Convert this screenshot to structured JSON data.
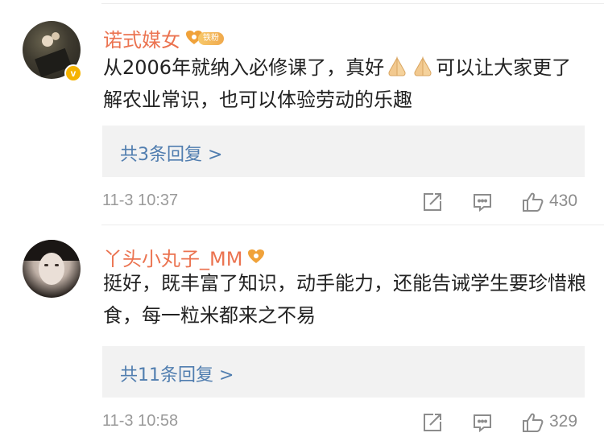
{
  "comments": [
    {
      "username": "诺式媒女",
      "badge_label": "铁粉",
      "verified_mark": "v",
      "text_part1": "从2006年就纳入必修课了，真好",
      "text_part2": "可以让大家更了解农业常识，也可以体验劳动的乐趣",
      "emoji": "praying-hands-icon",
      "replies_label": "共3条回复 >",
      "timestamp": "11-3 10:37",
      "like_count": "430"
    },
    {
      "username": "丫头小丸子_MM",
      "text": "挺好，既丰富了知识，动手能力，还能告诫学生要珍惜粮食，每一粒米都来之不易",
      "replies_label": "共11条回复 >",
      "timestamp": "11-3 10:58",
      "like_count": "329"
    }
  ],
  "colors": {
    "username": "#eb7350",
    "link": "#507daf",
    "meta": "#9a9a9a",
    "reply_bg": "#f2f2f2"
  }
}
